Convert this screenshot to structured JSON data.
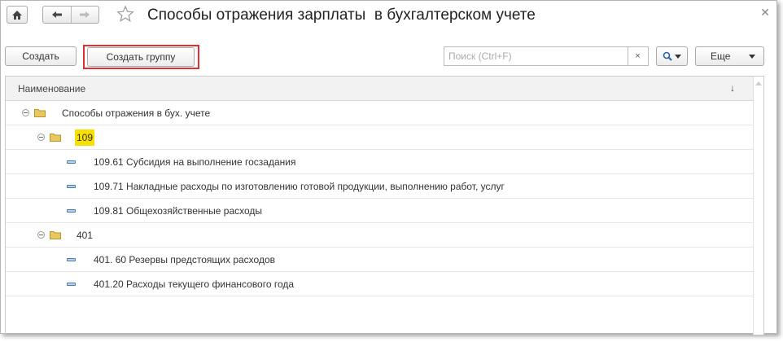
{
  "window": {
    "title": "Способы отражения зарплаты  в бухгалтерском учете"
  },
  "toolbar": {
    "create_label": "Создать",
    "create_group_label": "Создать группу",
    "search_placeholder": "Поиск (Ctrl+F)",
    "search_clear": "×",
    "more_label": "Еще"
  },
  "table": {
    "column_header": "Наименование",
    "sort_indicator": "↓",
    "rows": [
      {
        "label": "Способы отражения в бух. учете",
        "type": "group"
      },
      {
        "label": "109",
        "type": "group"
      },
      {
        "label": "109.61 Субсидия на выполнение госзадания",
        "type": "item"
      },
      {
        "label": "109.71 Накладные расходы по изготовлению готовой продукции, выполнению работ, услуг",
        "type": "item"
      },
      {
        "label": "109.81 Общехозяйственные расходы",
        "type": "item"
      },
      {
        "label": "401",
        "type": "group"
      },
      {
        "label": "401. 60 Резервы предстоящих расходов",
        "type": "item"
      },
      {
        "label": "401.20 Расходы текущего финансового года",
        "type": "item"
      }
    ]
  },
  "colors": {
    "highlight": "#f7e000",
    "focus_border": "#e03030",
    "folder": "#e8c860"
  },
  "icons": [
    "home-icon",
    "back-arrow-icon",
    "forward-arrow-icon",
    "favorite-star-icon",
    "close-icon",
    "search-icon",
    "dropdown-icon",
    "folder-icon",
    "collapse-icon",
    "catalog-item-icon"
  ]
}
